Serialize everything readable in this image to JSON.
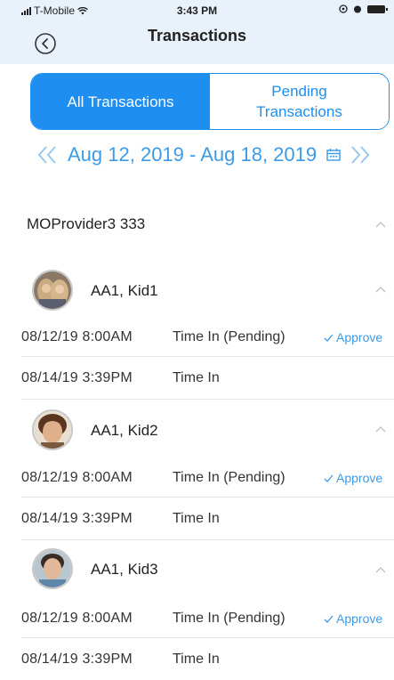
{
  "status_bar": {
    "carrier": "T-Mobile",
    "time": "3:43 PM"
  },
  "header": {
    "title": "Transactions",
    "back_icon": "back-circle-icon"
  },
  "tabs": {
    "all_label": "All Transactions",
    "pending_line1": "Pending",
    "pending_line2": "Transactions"
  },
  "date_nav": {
    "prev_icon": "double-chevron-left-icon",
    "range": "Aug 12, 2019 - Aug 18, 2019",
    "calendar_icon": "calendar-icon",
    "next_icon": "double-chevron-right-icon"
  },
  "provider": {
    "name": "MOProvider3 333"
  },
  "children": [
    {
      "name": "AA1, Kid1",
      "transactions": [
        {
          "datetime": "08/12/19 8:00AM",
          "status": "Time In (Pending)",
          "action": "Approve"
        },
        {
          "datetime": "08/14/19 3:39PM",
          "status": "Time In"
        }
      ]
    },
    {
      "name": "AA1, Kid2",
      "transactions": [
        {
          "datetime": "08/12/19 8:00AM",
          "status": "Time In (Pending)",
          "action": "Approve"
        },
        {
          "datetime": "08/14/19 3:39PM",
          "status": "Time In"
        }
      ]
    },
    {
      "name": "AA1, Kid3",
      "transactions": [
        {
          "datetime": "08/12/19 8:00AM",
          "status": "Time In (Pending)",
          "action": "Approve"
        },
        {
          "datetime": "08/14/19 3:39PM",
          "status": "Time In"
        }
      ]
    }
  ],
  "colors": {
    "accent": "#1e8ef0",
    "link": "#3b9be8",
    "header_bg": "#e9f2fa"
  }
}
